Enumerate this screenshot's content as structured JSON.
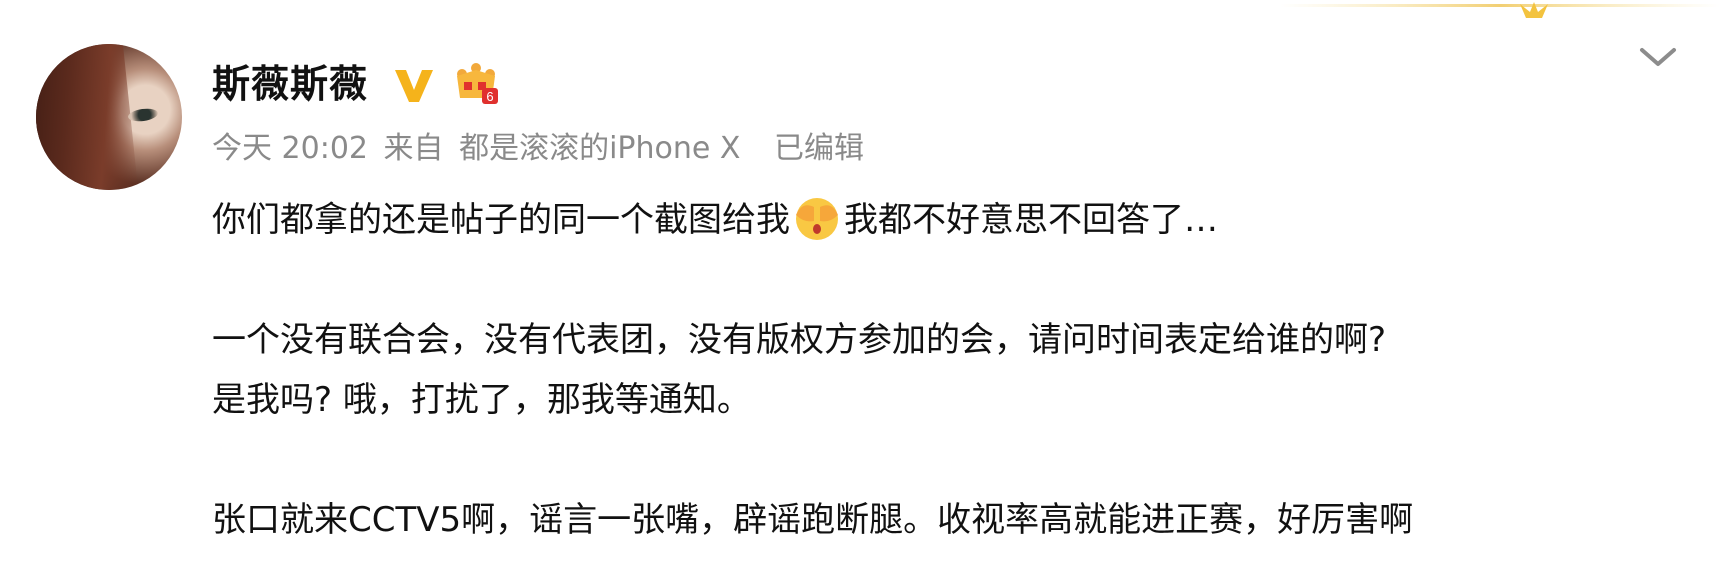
{
  "header": {
    "username": "斯薇斯薇",
    "verified_icon": "verified-v-badge",
    "member_icon": "crown-member-badge",
    "member_level": "6",
    "expand_icon": "chevron-down"
  },
  "meta": {
    "time": "今天 20:02",
    "from_label": "来自",
    "device": "都是滚滚的iPhone X",
    "edited": "已编辑"
  },
  "post": {
    "line1_before": "你们都拿的还是帖子的同一个截图给我",
    "line1_emoji": "shy-covering-eyes-emoji",
    "line1_after": "我都不好意思不回答了…",
    "line2": "一个没有联合会，没有代表团，没有版权方参加的会，请问时间表定给谁的啊?",
    "line3": "是我吗? 哦，打扰了，那我等通知。",
    "line4": "张口就来CCTV5啊，谣言一张嘴，辟谣跑断腿。收视率高就能进正赛，好厉害啊"
  },
  "colors": {
    "text": "#111111",
    "meta_text": "#8a8a8a",
    "verified_gold": "#f5b31b",
    "crown_gold": "#f2a93b",
    "crown_red": "#e0302e",
    "chevron": "#8c8c8c"
  }
}
